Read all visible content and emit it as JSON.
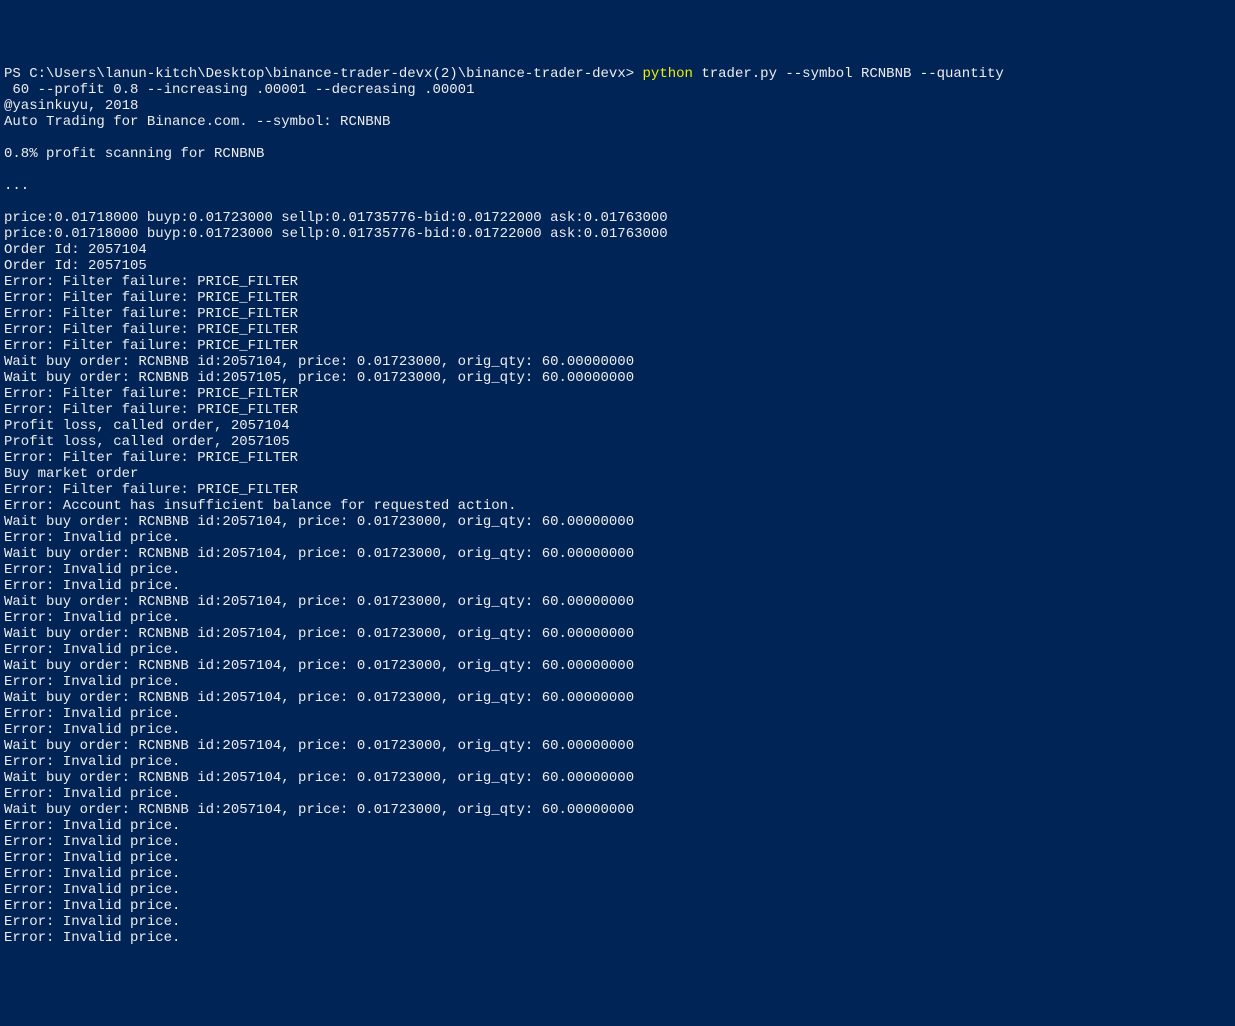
{
  "prompt": {
    "ps": "PS ",
    "path": "C:\\Users\\lanun-kitch\\Desktop\\binance-trader-devx(2)\\binance-trader-devx",
    "sep": "> ",
    "cmd_part1": "python",
    "cmd_part2": " trader.py --symbol RCNBNB --quantity",
    "cont": " 60 --profit 0.8 --increasing .00001 --decreasing .00001"
  },
  "lines": [
    "@yasinkuyu, 2018",
    "Auto Trading for Binance.com. --symbol: RCNBNB",
    "",
    "0.8% profit scanning for RCNBNB",
    "",
    "...",
    "",
    "price:0.01718000 buyp:0.01723000 sellp:0.01735776-bid:0.01722000 ask:0.01763000",
    "price:0.01718000 buyp:0.01723000 sellp:0.01735776-bid:0.01722000 ask:0.01763000",
    "Order Id: 2057104",
    "Order Id: 2057105",
    "Error: Filter failure: PRICE_FILTER",
    "Error: Filter failure: PRICE_FILTER",
    "Error: Filter failure: PRICE_FILTER",
    "Error: Filter failure: PRICE_FILTER",
    "Error: Filter failure: PRICE_FILTER",
    "Wait buy order: RCNBNB id:2057104, price: 0.01723000, orig_qty: 60.00000000",
    "Wait buy order: RCNBNB id:2057105, price: 0.01723000, orig_qty: 60.00000000",
    "Error: Filter failure: PRICE_FILTER",
    "Error: Filter failure: PRICE_FILTER",
    "Profit loss, called order, 2057104",
    "Profit loss, called order, 2057105",
    "Error: Filter failure: PRICE_FILTER",
    "Buy market order",
    "Error: Filter failure: PRICE_FILTER",
    "Error: Account has insufficient balance for requested action.",
    "Wait buy order: RCNBNB id:2057104, price: 0.01723000, orig_qty: 60.00000000",
    "Error: Invalid price.",
    "Wait buy order: RCNBNB id:2057104, price: 0.01723000, orig_qty: 60.00000000",
    "Error: Invalid price.",
    "Error: Invalid price.",
    "Wait buy order: RCNBNB id:2057104, price: 0.01723000, orig_qty: 60.00000000",
    "Error: Invalid price.",
    "Wait buy order: RCNBNB id:2057104, price: 0.01723000, orig_qty: 60.00000000",
    "Error: Invalid price.",
    "Wait buy order: RCNBNB id:2057104, price: 0.01723000, orig_qty: 60.00000000",
    "Error: Invalid price.",
    "Wait buy order: RCNBNB id:2057104, price: 0.01723000, orig_qty: 60.00000000",
    "Error: Invalid price.",
    "Error: Invalid price.",
    "Wait buy order: RCNBNB id:2057104, price: 0.01723000, orig_qty: 60.00000000",
    "Error: Invalid price.",
    "Wait buy order: RCNBNB id:2057104, price: 0.01723000, orig_qty: 60.00000000",
    "Error: Invalid price.",
    "Wait buy order: RCNBNB id:2057104, price: 0.01723000, orig_qty: 60.00000000",
    "Error: Invalid price.",
    "Error: Invalid price.",
    "Error: Invalid price.",
    "Error: Invalid price.",
    "Error: Invalid price.",
    "Error: Invalid price.",
    "Error: Invalid price.",
    "Error: Invalid price."
  ]
}
